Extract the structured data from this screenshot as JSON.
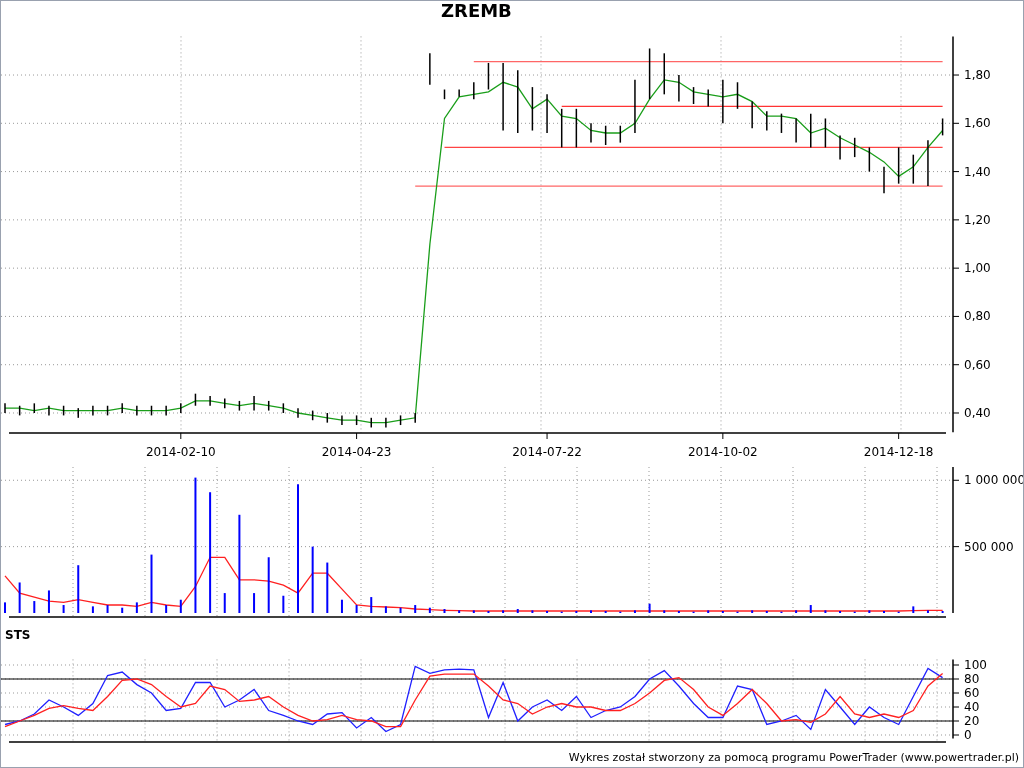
{
  "title": "ZREMB",
  "price_chart": {
    "chart_data": {
      "type": "line",
      "grid": true,
      "ylim": [
        0.32,
        1.96
      ],
      "categories": [
        null,
        null,
        null,
        null,
        null,
        null,
        null,
        null,
        null,
        null,
        null,
        null,
        "2014-02-10",
        null,
        null,
        null,
        null,
        null,
        null,
        null,
        null,
        null,
        null,
        null,
        "2014-04-23",
        null,
        null,
        null,
        null,
        null,
        null,
        null,
        null,
        null,
        null,
        null,
        null,
        "2014-07-22",
        null,
        null,
        null,
        null,
        null,
        null,
        null,
        null,
        null,
        null,
        null,
        "2014-10-02",
        null,
        null,
        null,
        null,
        null,
        null,
        null,
        null,
        null,
        null,
        null,
        "2014-12-18",
        null,
        null,
        null
      ],
      "yticks": [
        {
          "value": 0.4,
          "label": "0,40"
        },
        {
          "value": 0.6,
          "label": "0,60"
        },
        {
          "value": 0.8,
          "label": "0,80"
        },
        {
          "value": 1.0,
          "label": "1,00"
        },
        {
          "value": 1.2,
          "label": "1,20"
        },
        {
          "value": 1.4,
          "label": "1,40"
        },
        {
          "value": 1.6,
          "label": "1,60"
        },
        {
          "value": 1.8,
          "label": "1,80"
        }
      ],
      "series": [
        {
          "color": "#ff6666",
          "values": [
            null,
            null,
            null,
            null,
            null,
            null,
            null,
            null,
            null,
            null,
            null,
            null,
            null,
            null,
            null,
            null,
            null,
            null,
            null,
            null,
            null,
            null,
            null,
            null,
            null,
            null,
            null,
            null,
            null,
            null,
            null,
            null,
            1.855,
            1.855,
            1.855,
            1.855,
            1.855,
            1.855,
            1.855,
            1.855,
            1.855,
            1.855,
            1.855,
            1.855,
            1.855,
            1.855,
            1.855,
            1.855,
            1.855,
            1.855,
            1.855,
            1.855,
            1.855,
            1.855,
            1.855,
            1.855,
            1.855,
            1.855,
            1.855,
            1.855,
            1.855,
            1.855,
            1.855,
            1.855,
            1.855
          ]
        },
        {
          "color": "#ff3333",
          "values": [
            null,
            null,
            null,
            null,
            null,
            null,
            null,
            null,
            null,
            null,
            null,
            null,
            null,
            null,
            null,
            null,
            null,
            null,
            null,
            null,
            null,
            null,
            null,
            null,
            null,
            null,
            null,
            null,
            null,
            null,
            null,
            null,
            null,
            null,
            null,
            null,
            null,
            null,
            1.67,
            1.67,
            1.67,
            1.67,
            1.67,
            1.67,
            1.67,
            1.67,
            1.67,
            1.67,
            1.67,
            1.67,
            1.67,
            1.67,
            1.67,
            1.67,
            1.67,
            1.67,
            1.67,
            1.67,
            1.67,
            1.67,
            1.67,
            1.67,
            1.67,
            1.67,
            1.67
          ]
        },
        {
          "color": "#ff4444",
          "values": [
            null,
            null,
            null,
            null,
            null,
            null,
            null,
            null,
            null,
            null,
            null,
            null,
            null,
            null,
            null,
            null,
            null,
            null,
            null,
            null,
            null,
            null,
            null,
            null,
            null,
            null,
            null,
            null,
            null,
            null,
            1.5,
            1.5,
            1.5,
            1.5,
            1.5,
            1.5,
            1.5,
            1.5,
            1.5,
            1.5,
            1.5,
            1.5,
            1.5,
            1.5,
            1.5,
            1.5,
            1.5,
            1.5,
            1.5,
            1.5,
            1.5,
            1.5,
            1.5,
            1.5,
            1.5,
            1.5,
            1.5,
            1.5,
            1.5,
            1.5,
            1.5,
            1.5,
            1.5,
            1.5,
            1.5
          ]
        },
        {
          "color": "#ff6666",
          "values": [
            null,
            null,
            null,
            null,
            null,
            null,
            null,
            null,
            null,
            null,
            null,
            null,
            null,
            null,
            null,
            null,
            null,
            null,
            null,
            null,
            null,
            null,
            null,
            null,
            null,
            null,
            null,
            null,
            1.34,
            1.34,
            1.34,
            1.34,
            1.34,
            1.34,
            1.34,
            1.34,
            1.34,
            1.34,
            1.34,
            1.34,
            1.34,
            1.34,
            1.34,
            1.34,
            1.34,
            1.34,
            1.34,
            1.34,
            1.34,
            1.34,
            1.34,
            1.34,
            1.34,
            1.34,
            1.34,
            1.34,
            1.34,
            1.34,
            1.34,
            1.34,
            1.34,
            1.34,
            1.34,
            1.34,
            1.34
          ]
        },
        {
          "color": "#1a9e1a",
          "values": [
            0.42,
            0.42,
            0.41,
            0.42,
            0.41,
            0.41,
            0.41,
            0.41,
            0.42,
            0.41,
            0.41,
            0.41,
            0.42,
            0.45,
            0.45,
            0.44,
            0.43,
            0.44,
            0.43,
            0.42,
            0.4,
            0.39,
            0.38,
            0.37,
            0.37,
            0.36,
            0.36,
            0.37,
            0.38,
            1.1,
            1.62,
            1.71,
            1.72,
            1.73,
            1.77,
            1.75,
            1.66,
            1.7,
            1.63,
            1.62,
            1.57,
            1.56,
            1.56,
            1.6,
            1.7,
            1.78,
            1.77,
            1.73,
            1.72,
            1.71,
            1.72,
            1.69,
            1.63,
            1.63,
            1.62,
            1.56,
            1.58,
            1.54,
            1.51,
            1.48,
            1.44,
            1.38,
            1.42,
            1.5,
            1.57
          ]
        }
      ]
    }
  },
  "volume_chart": {
    "chart_data": {
      "type": "bar",
      "grid": true,
      "ylim": [
        0,
        1100000
      ],
      "categories": [
        null,
        null,
        null,
        null,
        null,
        null,
        null,
        null,
        null,
        null,
        null,
        null,
        null,
        null,
        null,
        null,
        null,
        null,
        null,
        null,
        null,
        null,
        null,
        null,
        null,
        null,
        null,
        null,
        null,
        null,
        null,
        null,
        null,
        null,
        null,
        null,
        null,
        null,
        null,
        null,
        null,
        null,
        null,
        null,
        null,
        null,
        null,
        null,
        null,
        null,
        null,
        null,
        null,
        null,
        null,
        null,
        null,
        null,
        null,
        null,
        null,
        null,
        null,
        null,
        null
      ],
      "yticks": [
        {
          "value": 500000,
          "label": "500 000"
        },
        {
          "value": 1000000,
          "label": "1 000 000"
        }
      ],
      "series": [
        {
          "color": "#0000ff",
          "values": [
            80000,
            230000,
            90000,
            170000,
            60000,
            360000,
            50000,
            60000,
            40000,
            80000,
            440000,
            60000,
            100000,
            1020000,
            910000,
            150000,
            740000,
            150000,
            420000,
            130000,
            970000,
            500000,
            380000,
            100000,
            60000,
            120000,
            50000,
            40000,
            60000,
            40000,
            30000,
            20000,
            20000,
            15000,
            20000,
            30000,
            20000,
            15000,
            10000,
            15000,
            20000,
            15000,
            10000,
            20000,
            70000,
            20000,
            15000,
            10000,
            20000,
            15000,
            10000,
            20000,
            15000,
            10000,
            20000,
            60000,
            20000,
            15000,
            10000,
            20000,
            15000,
            10000,
            50000,
            20000,
            15000
          ]
        },
        {
          "type": "line",
          "color": "#ff2020",
          "values": [
            280000,
            150000,
            120000,
            90000,
            80000,
            100000,
            80000,
            60000,
            60000,
            50000,
            80000,
            60000,
            50000,
            200000,
            420000,
            420000,
            250000,
            250000,
            240000,
            210000,
            150000,
            300000,
            300000,
            180000,
            60000,
            50000,
            45000,
            40000,
            30000,
            25000,
            20000,
            18000,
            15000,
            15000,
            15000,
            15000,
            15000,
            15000,
            15000,
            15000,
            15000,
            15000,
            15000,
            15000,
            15000,
            15000,
            15000,
            15000,
            15000,
            15000,
            15000,
            15000,
            15000,
            15000,
            15000,
            15000,
            15000,
            15000,
            15000,
            15000,
            15000,
            15000,
            18000,
            20000,
            20000
          ]
        }
      ]
    }
  },
  "oscillator": {
    "label": "STS",
    "chart_data": {
      "type": "line",
      "grid": true,
      "ylim": [
        -5,
        108
      ],
      "categories": [
        null,
        null,
        null,
        null,
        null,
        null,
        null,
        null,
        null,
        null,
        null,
        null,
        null,
        null,
        null,
        null,
        null,
        null,
        null,
        null,
        null,
        null,
        null,
        null,
        null,
        null,
        null,
        null,
        null,
        null,
        null,
        null,
        null,
        null,
        null,
        null,
        null,
        null,
        null,
        null,
        null,
        null,
        null,
        null,
        null,
        null,
        null,
        null,
        null,
        null,
        null,
        null,
        null,
        null,
        null,
        null,
        null,
        null,
        null,
        null,
        null,
        null,
        null,
        null,
        null
      ],
      "yticks": [
        0,
        20,
        40,
        60,
        80,
        100
      ],
      "series": [
        {
          "color": "#2020ff",
          "values": [
            15,
            20,
            30,
            50,
            40,
            28,
            45,
            85,
            90,
            72,
            60,
            35,
            38,
            75,
            75,
            40,
            50,
            65,
            35,
            28,
            20,
            15,
            30,
            32,
            10,
            25,
            5,
            15,
            98,
            88,
            93,
            94,
            93,
            25,
            75,
            20,
            40,
            50,
            35,
            55,
            25,
            35,
            40,
            55,
            80,
            92,
            70,
            45,
            25,
            25,
            70,
            65,
            15,
            20,
            28,
            8,
            65,
            40,
            15,
            40,
            25,
            15,
            55,
            95,
            82
          ]
        },
        {
          "color": "#ff2020",
          "values": [
            12,
            20,
            28,
            38,
            42,
            38,
            35,
            55,
            78,
            80,
            72,
            55,
            40,
            45,
            70,
            65,
            48,
            50,
            55,
            40,
            28,
            20,
            22,
            28,
            22,
            20,
            12,
            12,
            50,
            84,
            87,
            87,
            87,
            70,
            50,
            45,
            30,
            40,
            45,
            40,
            40,
            35,
            35,
            45,
            60,
            78,
            82,
            65,
            40,
            28,
            45,
            65,
            45,
            20,
            22,
            18,
            30,
            55,
            30,
            25,
            30,
            25,
            35,
            70,
            88
          ]
        }
      ]
    }
  },
  "footer": "Wykres został stworzony za pomocą programu PowerTrader (www.powertrader.pl)"
}
